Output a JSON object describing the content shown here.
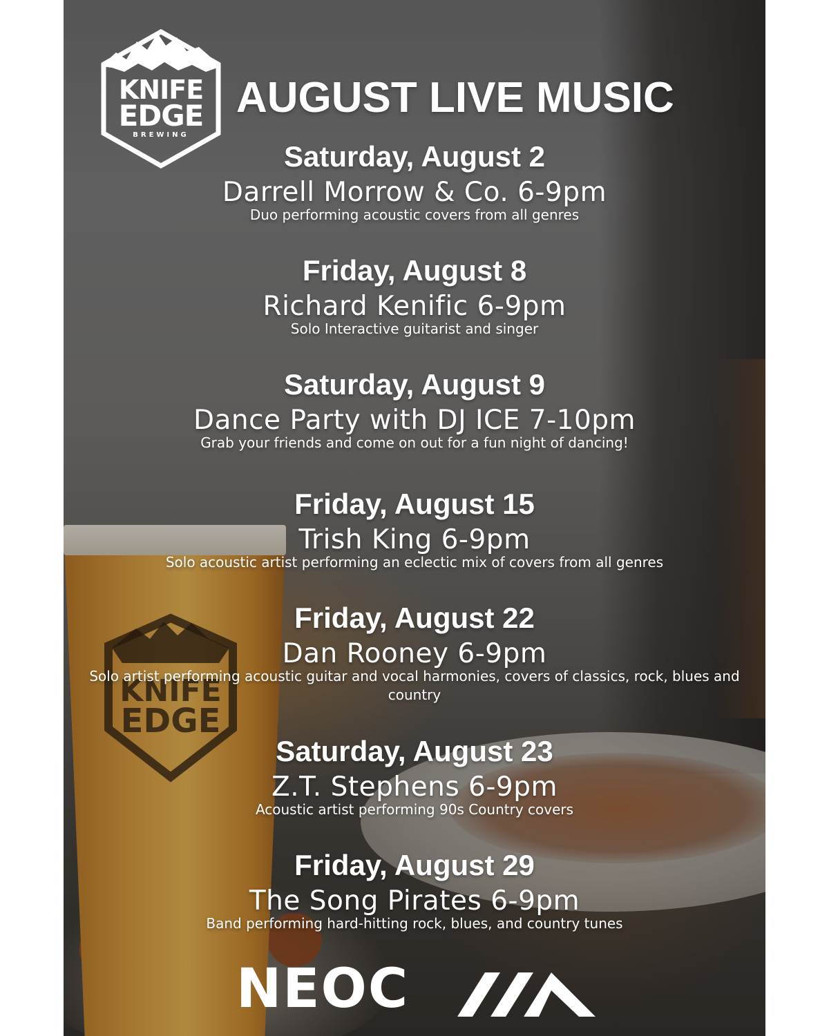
{
  "poster": {
    "title": "AUGUST LIVE MUSIC",
    "logo": {
      "line1": "KNIFE",
      "line2": "EDGE",
      "line3": "BREWING"
    },
    "events": [
      {
        "date": "Saturday, August 2",
        "act": "Darrell Morrow & Co. 6-9pm",
        "desc": "Duo performing acoustic covers from all genres"
      },
      {
        "date": "Friday, August 8",
        "act": "Richard Kenific 6-9pm",
        "desc": "Solo Interactive guitarist and singer"
      },
      {
        "date": "Saturday, August 9",
        "act": "Dance Party with DJ ICE 7-10pm",
        "desc": "Grab your friends and come on out for a fun night of dancing!"
      },
      {
        "date": "Friday, August 15",
        "act": "Trish King 6-9pm",
        "desc": "Solo acoustic artist performing an eclectic mix of covers from all genres"
      },
      {
        "date": "Friday, August 22",
        "act": "Dan Rooney 6-9pm",
        "desc": "Solo artist performing acoustic guitar and vocal harmonies, covers of classics, rock, blues and country"
      },
      {
        "date": "Saturday, August 23",
        "act": "Z.T. Stephens 6-9pm",
        "desc": "Acoustic artist performing 90s Country covers"
      },
      {
        "date": "Friday, August 29",
        "act": "The Song Pirates 6-9pm",
        "desc": "Band performing hard-hitting rock, blues, and country tunes"
      }
    ],
    "footer": {
      "brand": "NEOC"
    },
    "colors": {
      "text": "#ffffff",
      "beer": "#d99a3a"
    }
  }
}
